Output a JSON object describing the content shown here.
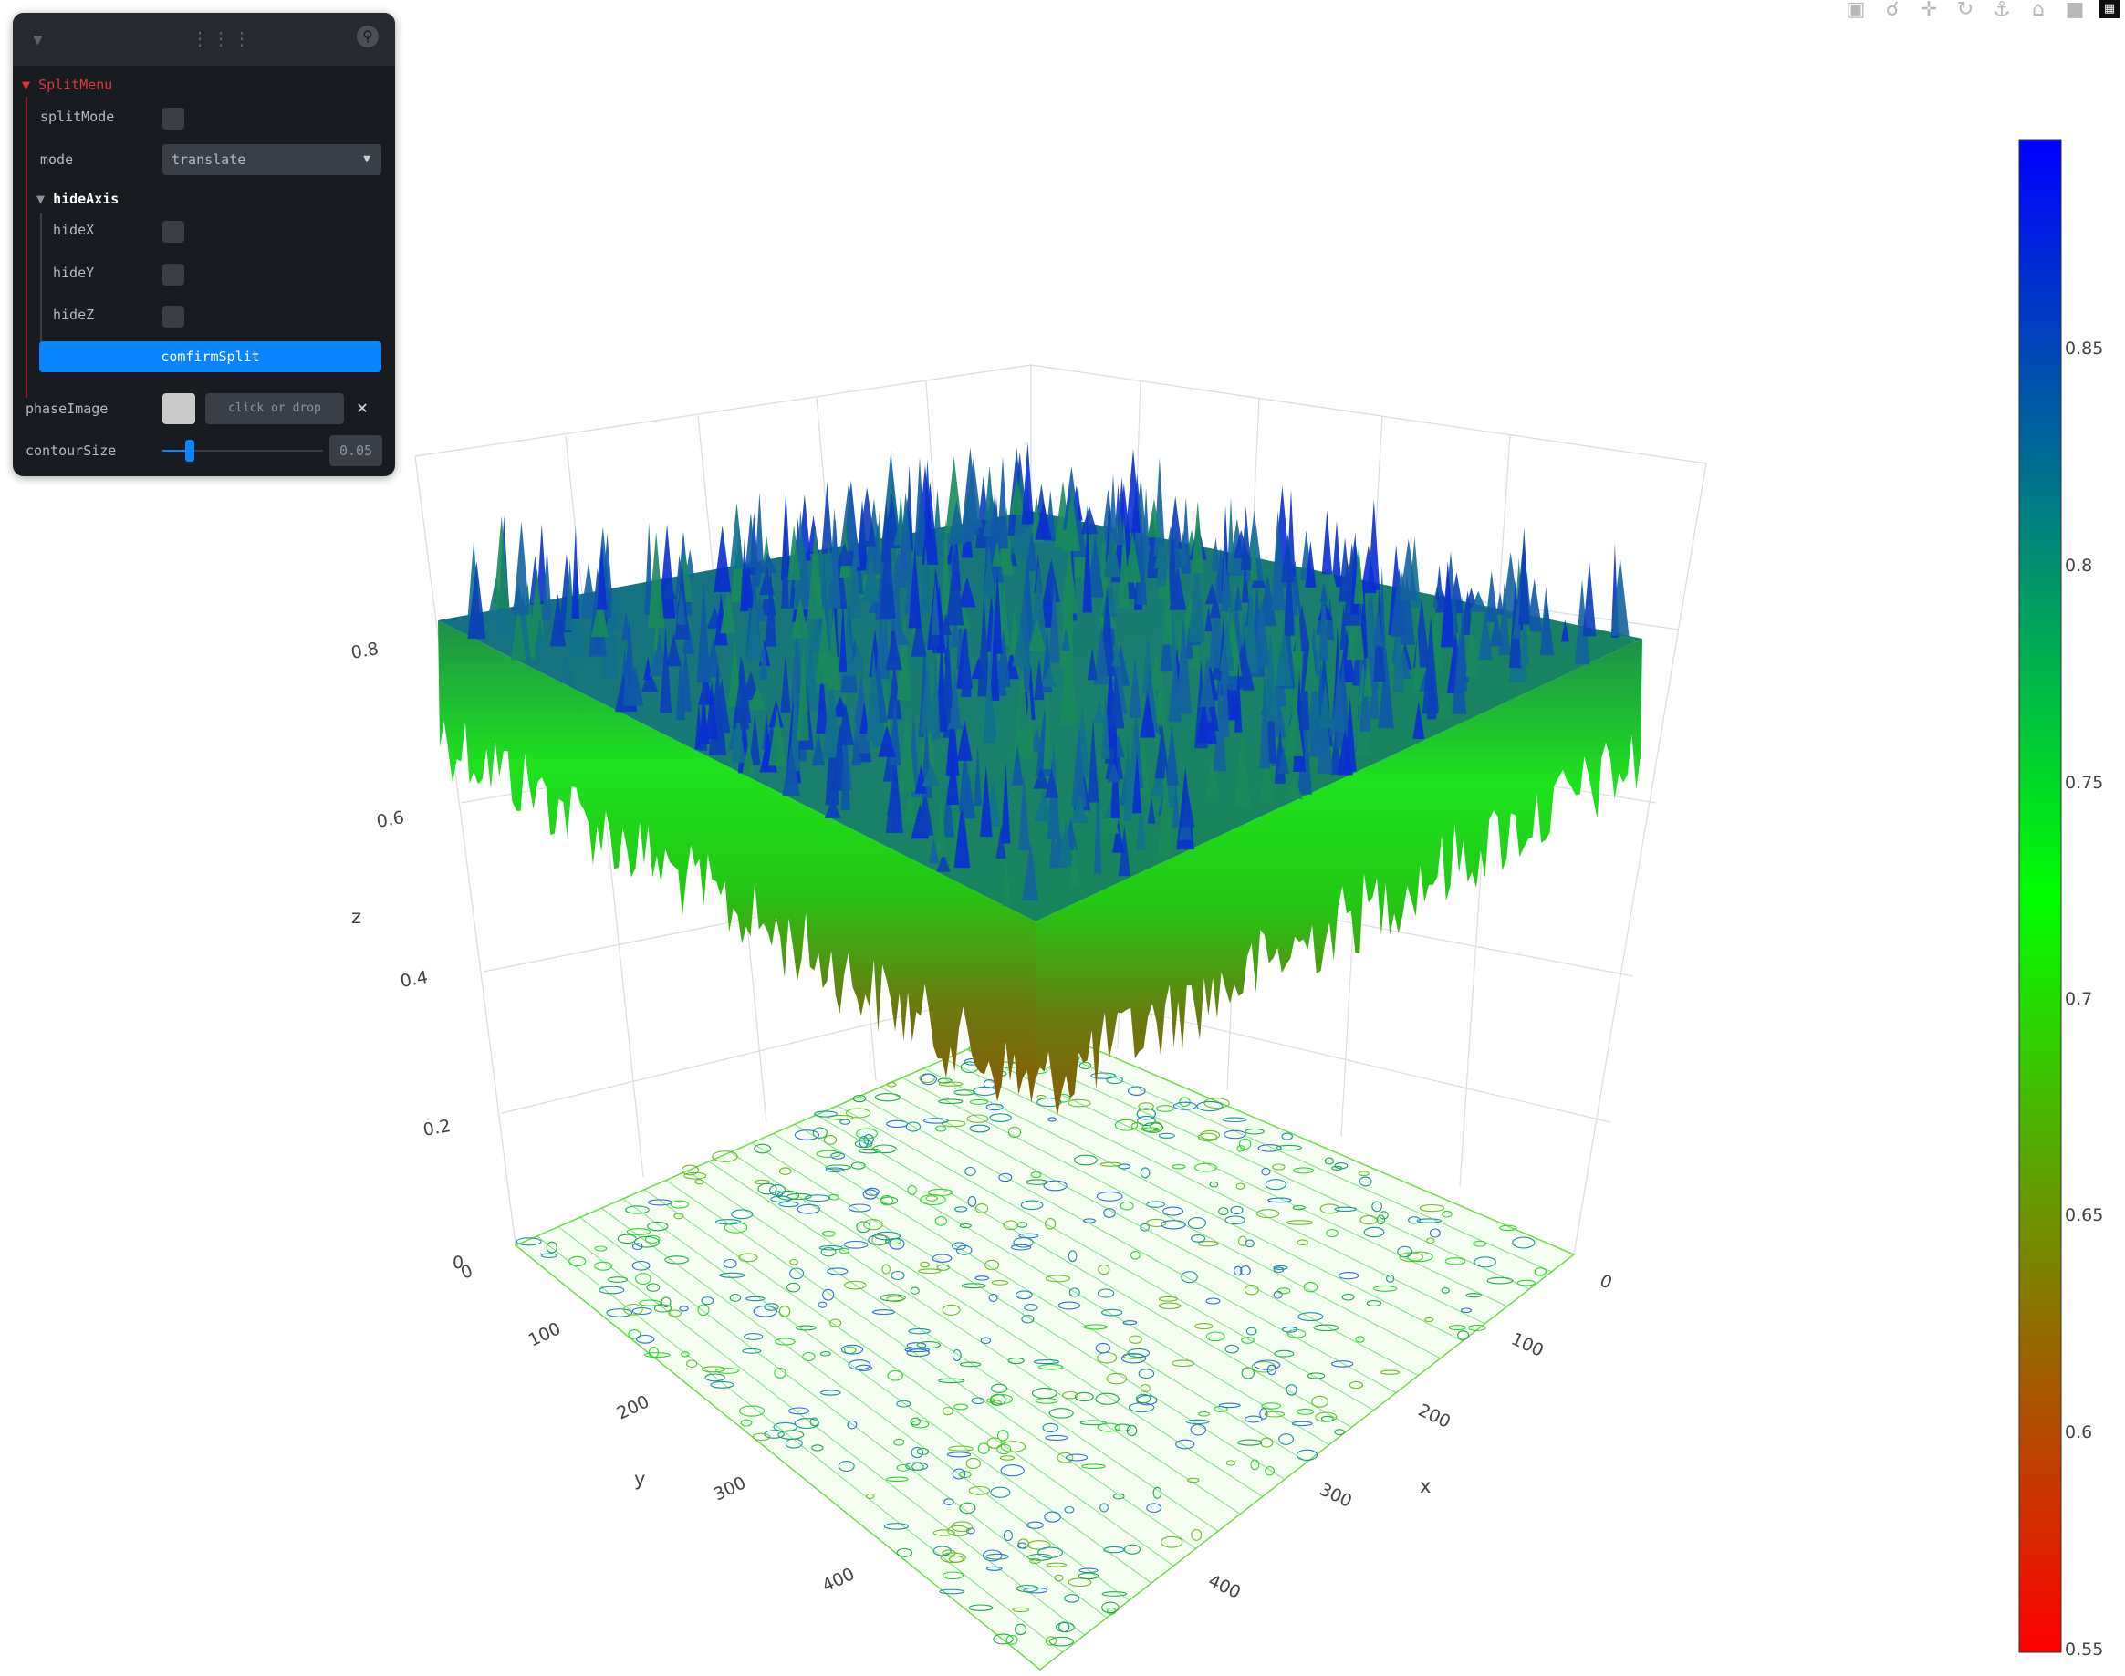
{
  "panel": {
    "folder_title": "SplitMenu",
    "split_mode_label": "splitMode",
    "mode_label": "mode",
    "mode_value": "translate",
    "hide_axis_title": "hideAxis",
    "hide_x_label": "hideX",
    "hide_y_label": "hideY",
    "hide_z_label": "hideZ",
    "confirm_button": "comfirmSplit",
    "phase_image_label": "phaseImage",
    "file_drop_text": "click or drop",
    "contour_size_label": "contourSize",
    "contour_size_value": "0.05",
    "contour_size_fraction": 0.17,
    "icons": [
      "chevron-down-icon",
      "drag-grip-icon",
      "search-icon",
      "close-icon"
    ]
  },
  "modebar": {
    "icons": [
      "camera-icon",
      "zoom-icon",
      "pan-icon",
      "orbit-icon",
      "turntable-icon",
      "home-icon",
      "camera-video-icon",
      "plotly-logo-icon"
    ]
  },
  "chart_data": {
    "type": "surface",
    "title": "",
    "x_axis": {
      "label": "x",
      "ticks": [
        "0",
        "100",
        "200",
        "300",
        "400"
      ],
      "range": [
        0,
        480
      ]
    },
    "y_axis": {
      "label": "y",
      "ticks": [
        "0",
        "100",
        "200",
        "300",
        "400"
      ],
      "range": [
        0,
        480
      ]
    },
    "z_axis": {
      "label": "z",
      "ticks": [
        "0",
        "0.2",
        "0.4",
        "0.6",
        "0.8"
      ],
      "range": [
        0,
        0.9
      ]
    },
    "surface": {
      "z_base": 0.75,
      "z_min": 0.56,
      "z_max": 0.9,
      "description_values": "noisy periodic surface with spikes"
    },
    "contour_projection": {
      "z": 0,
      "contour_size": 0.05
    },
    "colorbar": {
      "ticks": [
        "0.55",
        "0.6",
        "0.65",
        "0.7",
        "0.75",
        "0.8",
        "0.85"
      ],
      "range": [
        0.55,
        0.9
      ],
      "colorscale": [
        [
          "0",
          "#ff0000"
        ],
        [
          "0.5",
          "#00ff00"
        ],
        [
          "1",
          "#0000ff"
        ]
      ]
    },
    "grid": true
  }
}
